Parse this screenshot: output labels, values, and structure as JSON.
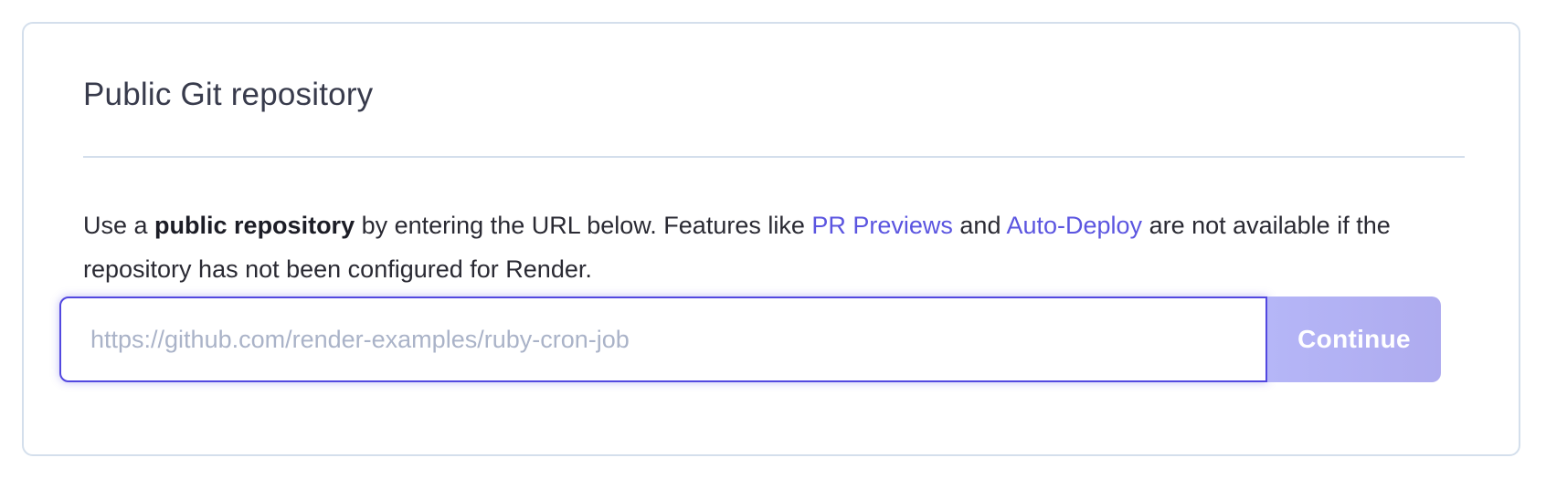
{
  "card": {
    "title": "Public Git repository",
    "description": {
      "part1": "Use a ",
      "bold": "public repository",
      "part2": " by entering the URL below. Features like ",
      "link1": "PR Previews",
      "part3": " and ",
      "link2": "Auto-Deploy",
      "part4": " are not available if the repository has not been configured for Render."
    },
    "input": {
      "value": "",
      "placeholder": "https://github.com/render-examples/ruby-cron-job"
    },
    "continue_label": "Continue"
  },
  "colors": {
    "accent": "#5248e0",
    "link": "#5b55e0",
    "button_disabled": "#b5b6f7",
    "border": "#d4dfec"
  }
}
